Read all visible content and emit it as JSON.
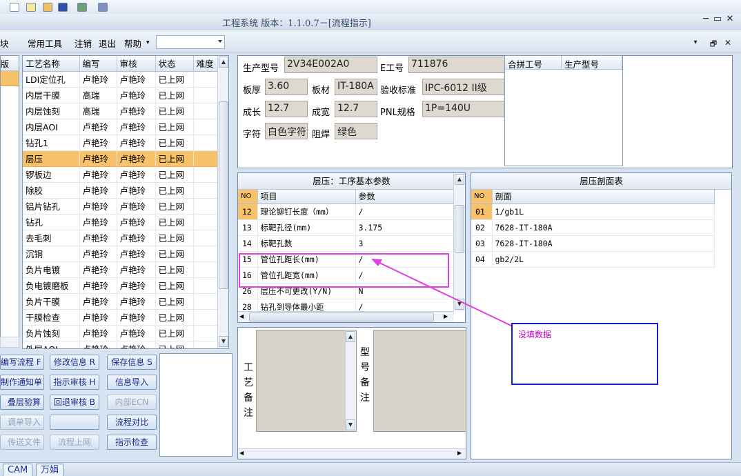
{
  "window": {
    "title": "工程系统 版本：1.1.0.7－[流程指示]",
    "controls": [
      "─",
      "▭",
      "✕"
    ],
    "mdi_controls": [
      "▾",
      "🗗",
      "✕"
    ]
  },
  "menu": {
    "partial_left": "块",
    "items": [
      "常用工具",
      "注销",
      "退出",
      "帮助"
    ],
    "help_arrow": "▾"
  },
  "left_strip": {
    "header": "版"
  },
  "process_grid": {
    "columns": [
      "工艺名称",
      "编写",
      "审核",
      "状态",
      "难度"
    ],
    "selected_index": 5,
    "rows": [
      [
        "LDI定位孔",
        "卢艳玲",
        "卢艳玲",
        "已上网",
        ""
      ],
      [
        "内层干膜",
        "高瑞",
        "卢艳玲",
        "已上网",
        ""
      ],
      [
        "内层蚀刻",
        "高瑞",
        "卢艳玲",
        "已上网",
        ""
      ],
      [
        "内层AOI",
        "卢艳玲",
        "卢艳玲",
        "已上网",
        ""
      ],
      [
        "钻孔1",
        "卢艳玲",
        "卢艳玲",
        "已上网",
        ""
      ],
      [
        "层压",
        "卢艳玲",
        "卢艳玲",
        "已上网",
        ""
      ],
      [
        "锣板边",
        "卢艳玲",
        "卢艳玲",
        "已上网",
        ""
      ],
      [
        "除胶",
        "卢艳玲",
        "卢艳玲",
        "已上网",
        ""
      ],
      [
        "铝片钻孔",
        "卢艳玲",
        "卢艳玲",
        "已上网",
        ""
      ],
      [
        "钻孔",
        "卢艳玲",
        "卢艳玲",
        "已上网",
        ""
      ],
      [
        "去毛刺",
        "卢艳玲",
        "卢艳玲",
        "已上网",
        ""
      ],
      [
        "沉铜",
        "卢艳玲",
        "卢艳玲",
        "已上网",
        ""
      ],
      [
        "负片电镀",
        "卢艳玲",
        "卢艳玲",
        "已上网",
        ""
      ],
      [
        "负电镀磨板",
        "卢艳玲",
        "卢艳玲",
        "已上网",
        ""
      ],
      [
        "负片干膜",
        "卢艳玲",
        "卢艳玲",
        "已上网",
        ""
      ],
      [
        "干膜检查",
        "卢艳玲",
        "卢艳玲",
        "已上网",
        ""
      ],
      [
        "负片蚀刻",
        "卢艳玲",
        "卢艳玲",
        "已上网",
        ""
      ],
      [
        "外层AOI",
        "卢艳玲",
        "卢艳玲",
        "已上网",
        ""
      ]
    ]
  },
  "buttons": {
    "edit_flow": "编写流程 F",
    "modify_info": "修改信息 R",
    "save_info": "保存信息 S",
    "make_notice": "制作通知单",
    "indicate_review": "指示审核 H",
    "info_import": "信息导入",
    "stack_calc": "叠层验算",
    "return_review": "回退审核 B",
    "internal_ecn": "内部ECN",
    "order_import": "调单导入",
    "blank": "",
    "flow_compare": "流程对比",
    "transfer_file": "传送文件",
    "flow_online": "流程上网",
    "indicate_check": "指示检查"
  },
  "info": {
    "model_label": "生产型号",
    "model": "2V34E002A0",
    "e_label": "E工号",
    "e_no": "711876",
    "thickness_label": "板厚",
    "thickness": "3.60",
    "material_label": "板材",
    "material": "IT-180A",
    "standard_label": "验收标准",
    "standard": "IPC-6012 II级",
    "length_label": "成长",
    "length": "12.7",
    "width_label": "成宽",
    "width": "12.7",
    "pnl_label": "PNL规格",
    "pnl": "1P=140U",
    "char_label": "字符",
    "char": "白色字符",
    "mask_label": "阻焊",
    "mask": "绿色"
  },
  "merge_grid": {
    "columns": [
      "合拼工号",
      "生产型号"
    ]
  },
  "params_panel": {
    "title": "层压：工序基本参数",
    "columns": [
      "NO",
      "项目",
      "参数"
    ],
    "rows": [
      [
        "12",
        "理论铆钉长度（mm）",
        "/"
      ],
      [
        "13",
        "标靶孔径(mm)",
        "3.175"
      ],
      [
        "14",
        "标靶孔数",
        "3"
      ],
      [
        "15",
        "管位孔距长(mm)",
        "/"
      ],
      [
        "16",
        "管位孔距宽(mm)",
        "/"
      ],
      [
        "26",
        "层压不可更改(Y/N)",
        "N"
      ],
      [
        "28",
        "钻孔到导体最小距",
        "/"
      ]
    ]
  },
  "section_panel": {
    "title": "层压剖面表",
    "columns": [
      "NO",
      "剖面"
    ],
    "rows": [
      [
        "01",
        "1/gb1L"
      ],
      [
        "02",
        "7628-IT-180A"
      ],
      [
        "03",
        "7628-IT-180A"
      ],
      [
        "04",
        "gb2/2L"
      ]
    ]
  },
  "memo": {
    "process_note": [
      "工",
      "艺",
      "备",
      "注"
    ],
    "model_note": [
      "型",
      "号",
      "备",
      "注"
    ]
  },
  "status_tabs": [
    "CAM",
    "万娟"
  ],
  "annotation": {
    "text": "没填数据"
  },
  "colors": {
    "selected_row": "#f8c26a",
    "annotation_border": "#1020d0",
    "annotation_text": "#c000c0",
    "highlight": "#e040e0"
  }
}
